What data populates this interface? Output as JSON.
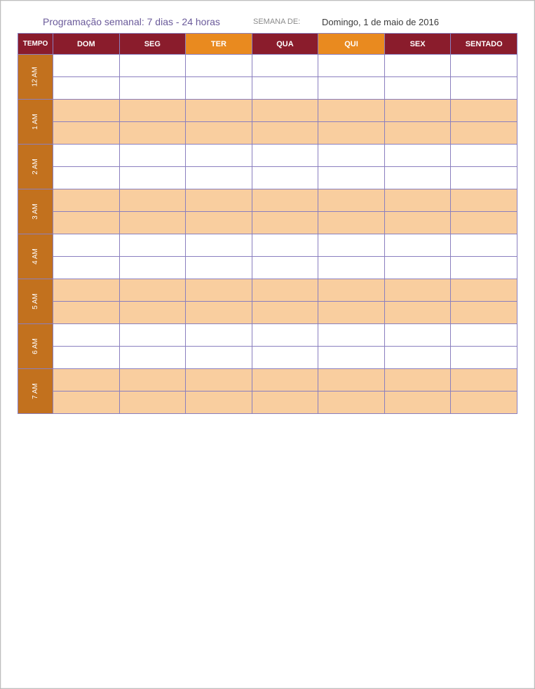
{
  "header": {
    "title": "Programação semanal: 7 dias - 24 horas",
    "week_of_label": "SEMANA DE:",
    "week_of_date": "Domingo, 1 de maio de 2016"
  },
  "table": {
    "time_header": "TEMPO",
    "days": [
      "DOM",
      "SEG",
      "TER",
      "QUA",
      "QUI",
      "SEX",
      "SENTADO"
    ],
    "day_header_colors": [
      "maroon",
      "maroon",
      "orange",
      "maroon",
      "orange",
      "maroon",
      "maroon"
    ],
    "time_slots": [
      "12 AM",
      "1 AM",
      "2 AM",
      "3 AM",
      "4 AM",
      "5 AM",
      "6 AM",
      "7 AM"
    ],
    "slot_shaded": [
      false,
      true,
      false,
      true,
      false,
      true,
      false,
      true
    ]
  }
}
